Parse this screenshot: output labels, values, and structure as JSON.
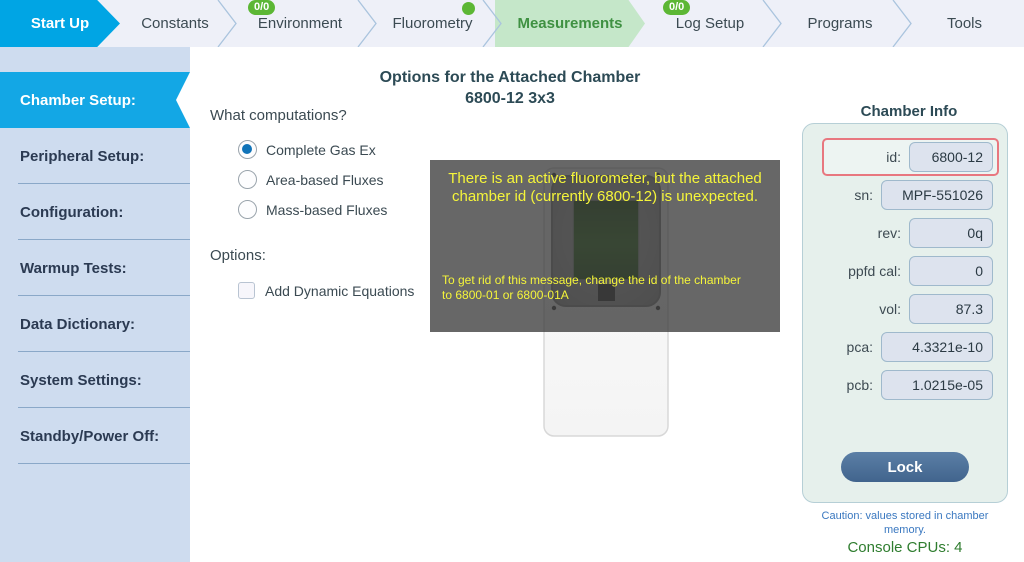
{
  "breadcrumb": {
    "items": [
      {
        "label": "Start Up",
        "state": "selected",
        "badge": null,
        "dot": false
      },
      {
        "label": "Constants",
        "state": "normal",
        "badge": null,
        "dot": false
      },
      {
        "label": "Environment",
        "state": "normal",
        "badge": "0/0",
        "dot": false
      },
      {
        "label": "Fluorometry",
        "state": "normal",
        "badge": null,
        "dot": true
      },
      {
        "label": "Measurements",
        "state": "current",
        "badge": null,
        "dot": false
      },
      {
        "label": "Log Setup",
        "state": "normal",
        "badge": "0/0",
        "dot": false
      },
      {
        "label": "Programs",
        "state": "normal",
        "badge": null,
        "dot": false
      },
      {
        "label": "Tools",
        "state": "normal",
        "badge": null,
        "dot": false
      }
    ]
  },
  "sidebar": {
    "items": [
      {
        "label": "Chamber Setup:",
        "active": true
      },
      {
        "label": "Peripheral Setup:",
        "active": false
      },
      {
        "label": "Configuration:",
        "active": false
      },
      {
        "label": "Warmup Tests:",
        "active": false
      },
      {
        "label": "Data Dictionary:",
        "active": false
      },
      {
        "label": "System Settings:",
        "active": false
      },
      {
        "label": "Standby/Power Off:",
        "active": false
      }
    ]
  },
  "main": {
    "title_line1": "Options for the Attached Chamber",
    "title_line2": "6800-12 3x3",
    "computations_label": "What computations?",
    "computation_options": [
      {
        "label": "Complete Gas Ex",
        "selected": true
      },
      {
        "label": "Area-based Fluxes",
        "selected": false
      },
      {
        "label": "Mass-based Fluxes",
        "selected": false
      }
    ],
    "options_label": "Options:",
    "dynamic_equations": {
      "label": "Add Dynamic Equations",
      "checked": false
    }
  },
  "warning": {
    "primary": "There is an active fluorometer, but the attached chamber id (currently 6800-12) is unexpected.",
    "secondary": "To get rid of this message, change the id of the chamber to 6800-01 or 6800-01A"
  },
  "chamber_info": {
    "title": "Chamber Info",
    "fields": [
      {
        "label": "id:",
        "value": "6800-12",
        "highlighted": true
      },
      {
        "label": "sn:",
        "value": "MPF-551026",
        "highlighted": false
      },
      {
        "label": "rev:",
        "value": "0q",
        "highlighted": false
      },
      {
        "label": "ppfd cal:",
        "value": "0",
        "highlighted": false
      },
      {
        "label": "vol:",
        "value": "87.3",
        "highlighted": false
      },
      {
        "label": "pca:",
        "value": "4.3321e-10",
        "highlighted": false
      },
      {
        "label": "pcb:",
        "value": "1.0215e-05",
        "highlighted": false
      }
    ],
    "lock_button": "Lock",
    "caution": "Caution: values stored in chamber memory."
  },
  "status": {
    "console_cpus": "Console CPUs: 4"
  },
  "colors": {
    "accent_blue": "#00a5e4",
    "sidebar_bg": "#cedcef",
    "active_sidebar": "#13a7e5",
    "current_tab_bg": "#c5e7c9",
    "current_tab_text": "#3f9142",
    "badge_green": "#5cb735",
    "warning_text": "#f5f53a",
    "warning_bg": "rgba(60,60,60,0.78)",
    "highlight_red": "#e8777f",
    "cpus_green": "#2f7d2f",
    "caution_blue": "#3a78c0"
  }
}
